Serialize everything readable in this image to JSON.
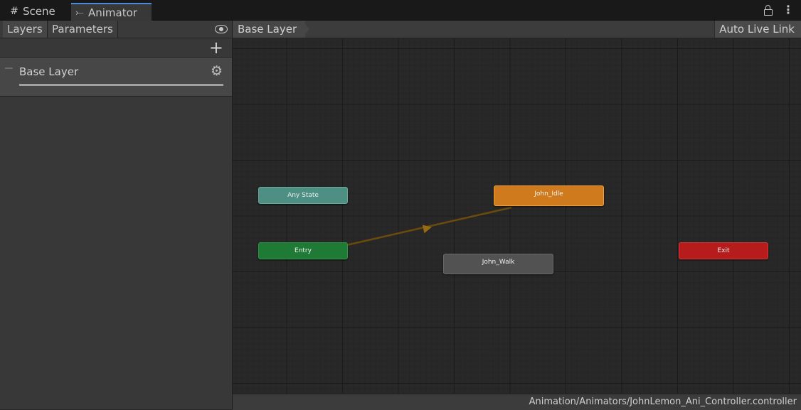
{
  "tabs": {
    "scene": {
      "label": "Scene",
      "icon": "grid-icon"
    },
    "animator": {
      "label": "Animator",
      "icon": "animator-icon"
    }
  },
  "window_icons": [
    "lock-icon",
    "kebab-icon"
  ],
  "left_panel": {
    "tabs": [
      "Layers",
      "Parameters"
    ],
    "visibility_icon": "eye-icon",
    "add_icon": "plus-icon",
    "layers": [
      {
        "name": "Base Layer",
        "settings_icon": "gear-icon"
      }
    ]
  },
  "graph": {
    "breadcrumb": "Base Layer",
    "auto_live_link_label": "Auto Live Link",
    "states": {
      "any_state": "Any State",
      "entry": "Entry",
      "idle": "John_Idle",
      "walk": "John_Walk",
      "exit": "Exit"
    },
    "transition_color": "#6b4a0e",
    "state_colors": {
      "any_state": "#4d8f83",
      "entry": "#1f7a36",
      "default": "#d07a1e",
      "normal": "#525253",
      "exit": "#b71c1c"
    }
  },
  "status": {
    "asset_path": "Animation/Animators/JohnLemon_Ani_Controller.controller"
  }
}
